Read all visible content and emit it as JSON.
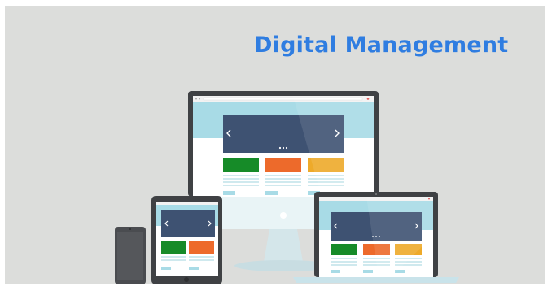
{
  "headline": "Digital Management",
  "colors": {
    "panel": "#dcdddb",
    "headline": "#2f7de1",
    "device_frame": "#3f4144",
    "phone_body": "#4a4c50",
    "screen_header": "#a8dbe6",
    "hero_slide": "#3e5272",
    "card_green": "#168b28",
    "card_orange": "#ed6a2b",
    "card_yellow": "#eeaa2a",
    "content_lines": "#cfe9ee",
    "stand": "#d4e6ea"
  },
  "scene": {
    "devices": [
      "desktop-monitor",
      "tablet",
      "laptop",
      "smartphone"
    ],
    "carousel": {
      "prev_glyph": "‹",
      "next_glyph": "›",
      "pager_dots": 3
    },
    "cards": [
      "green",
      "orange",
      "yellow"
    ]
  }
}
